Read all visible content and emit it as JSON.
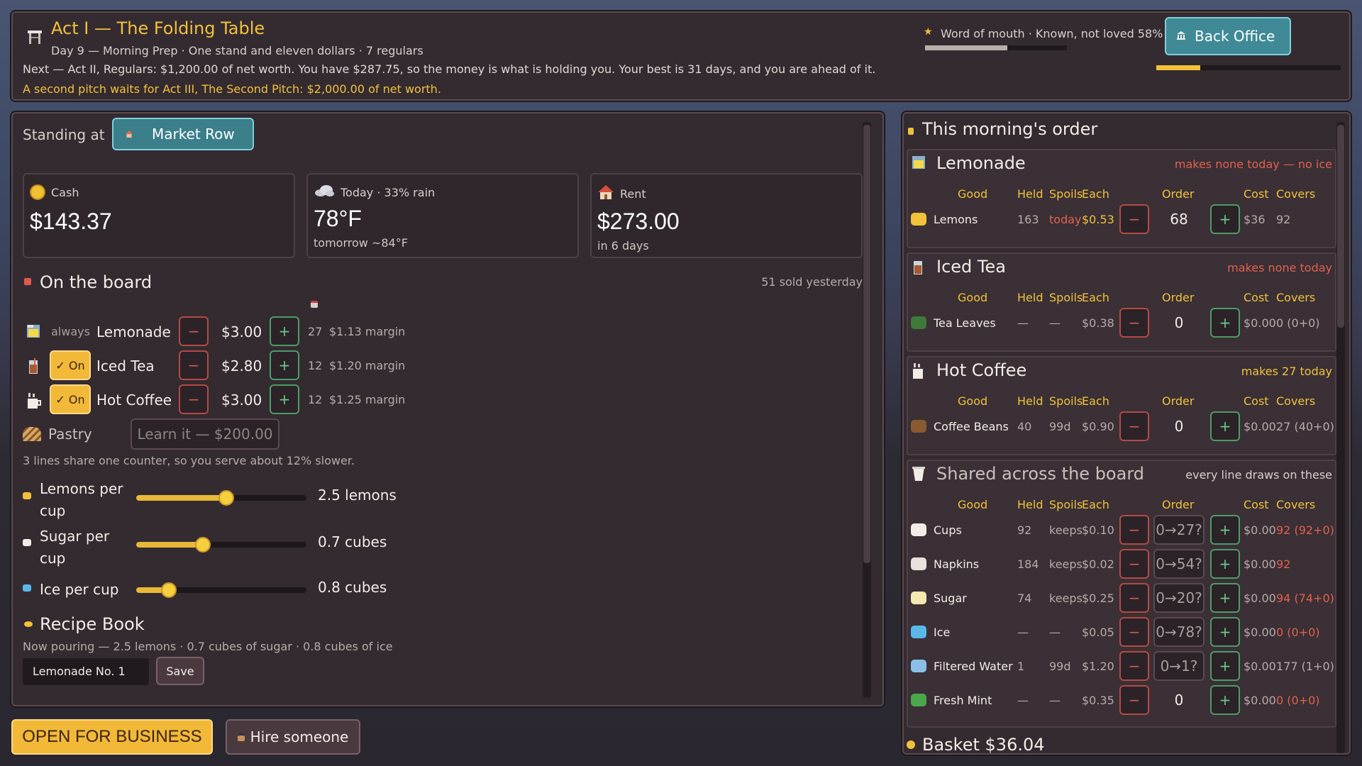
{
  "header": {
    "title": "Act I — The Folding Table",
    "subtitle": "Day 9 — Morning Prep · One stand and eleven dollars · 7 regulars",
    "next_line": "Next — Act II, Regulars: $1,200.00 of net worth. You have $287.75, so the money is what is holding you. Your best is 31 days, and you are ahead of it.",
    "pitch_line": "A second pitch waits for Act III, The Second Pitch: $2,000.00 of net worth.",
    "reputation_label": "Word of mouth · Known, not loved 58%",
    "reputation_pct": 58,
    "back_office_label": "Back Office",
    "back_office_progress_pct": 24
  },
  "stand": {
    "standing_at_label": "Standing at",
    "location": "Market Row",
    "cash_label": "Cash",
    "cash_value": "$143.37",
    "weather_label": "Today · 33% rain",
    "weather_value": "78°F",
    "weather_sub": "tomorrow ~84°F",
    "rent_label": "Rent",
    "rent_value": "$273.00",
    "rent_sub": "in 6 days"
  },
  "board": {
    "title": "On the board",
    "sold_yesterday": "51 sold yesterday",
    "products": [
      {
        "toggle": "always",
        "name": "Lemonade",
        "price": "$3.00",
        "count": "27",
        "margin": "$1.13 margin"
      },
      {
        "toggle": "✓ On",
        "name": "Iced Tea",
        "price": "$2.80",
        "count": "12",
        "margin": "$1.20 margin"
      },
      {
        "toggle": "✓ On",
        "name": "Hot Coffee",
        "price": "$3.00",
        "count": "12",
        "margin": "$1.25 margin"
      }
    ],
    "pastry_name": "Pastry",
    "pastry_learn": "Learn it — $200.00",
    "counter_note": "3 lines share one counter, so you serve about 12% slower.",
    "sliders": [
      {
        "label": "Lemons per cup",
        "value": "2.5 lemons",
        "level": 0.53
      },
      {
        "label": "Sugar per cup",
        "value": "0.7 cubes",
        "level": 0.39
      },
      {
        "label": "Ice per cup",
        "value": "0.8 cubes",
        "level": 0.19
      }
    ],
    "recipe_title": "Recipe Book",
    "recipe_now": "Now pouring — 2.5 lemons · 0.7 cubes of sugar · 0.8 cubes of ice",
    "recipe_name": "Lemonade No. 1",
    "save_label": "Save"
  },
  "actions": {
    "open_label": "OPEN FOR BUSINESS",
    "hire_label": "Hire someone"
  },
  "order": {
    "title": "This morning's order",
    "columns": {
      "good": "Good",
      "held": "Held",
      "spoils": "Spoils",
      "each": "Each",
      "order": "Order",
      "cost": "Cost",
      "covers": "Covers"
    },
    "minus": "−",
    "plus": "+",
    "sections": [
      {
        "name": "Lemonade",
        "note": "makes none today — no ice",
        "rows": [
          {
            "good": "Lemons",
            "held": "163",
            "spoils": "today",
            "each": "$0.53",
            "order": "68",
            "cost": "$36",
            "covers": "92"
          }
        ]
      },
      {
        "name": "Iced Tea",
        "note": "makes none today",
        "rows": [
          {
            "good": "Tea Leaves",
            "held": "—",
            "spoils": "—",
            "each": "$0.38",
            "order": "0",
            "cost": "$0.00",
            "covers": "0 (0+0)"
          }
        ]
      },
      {
        "name": "Hot Coffee",
        "note": "makes 27 today",
        "rows": [
          {
            "good": "Coffee Beans",
            "held": "40",
            "spoils": "99d",
            "each": "$0.90",
            "order": "0",
            "cost": "$0.00",
            "covers": "27 (40+0)"
          }
        ]
      },
      {
        "name": "Shared across the board",
        "note": "every line draws on these",
        "rows": [
          {
            "good": "Cups",
            "held": "92",
            "spoils": "keeps",
            "each": "$0.10",
            "order": "0→27?",
            "cost": "$0.00",
            "covers": "92 (92+0)"
          },
          {
            "good": "Napkins",
            "held": "184",
            "spoils": "keeps",
            "each": "$0.02",
            "order": "0→54?",
            "cost": "$0.00",
            "covers": "92"
          },
          {
            "good": "Sugar",
            "held": "74",
            "spoils": "keeps",
            "each": "$0.25",
            "order": "0→20?",
            "cost": "$0.00",
            "covers": "94 (74+0)"
          },
          {
            "good": "Ice",
            "held": "—",
            "spoils": "—",
            "each": "$0.05",
            "order": "0→78?",
            "cost": "$0.00",
            "covers": "0 (0+0)"
          },
          {
            "good": "Filtered Water",
            "held": "1",
            "spoils": "99d",
            "each": "$1.20",
            "order": "0→1?",
            "cost": "$0.00",
            "covers": "177 (1+0)"
          },
          {
            "good": "Fresh Mint",
            "held": "—",
            "spoils": "—",
            "each": "$0.35",
            "order": "0",
            "cost": "$0.00",
            "covers": "0 (0+0)"
          }
        ]
      }
    ],
    "basket_label": "Basket $36.04"
  },
  "colors": {
    "accent": "#f2c13a",
    "warning": "#e2614d",
    "teal_button": "#3f8a96",
    "panel": "#342b31"
  }
}
